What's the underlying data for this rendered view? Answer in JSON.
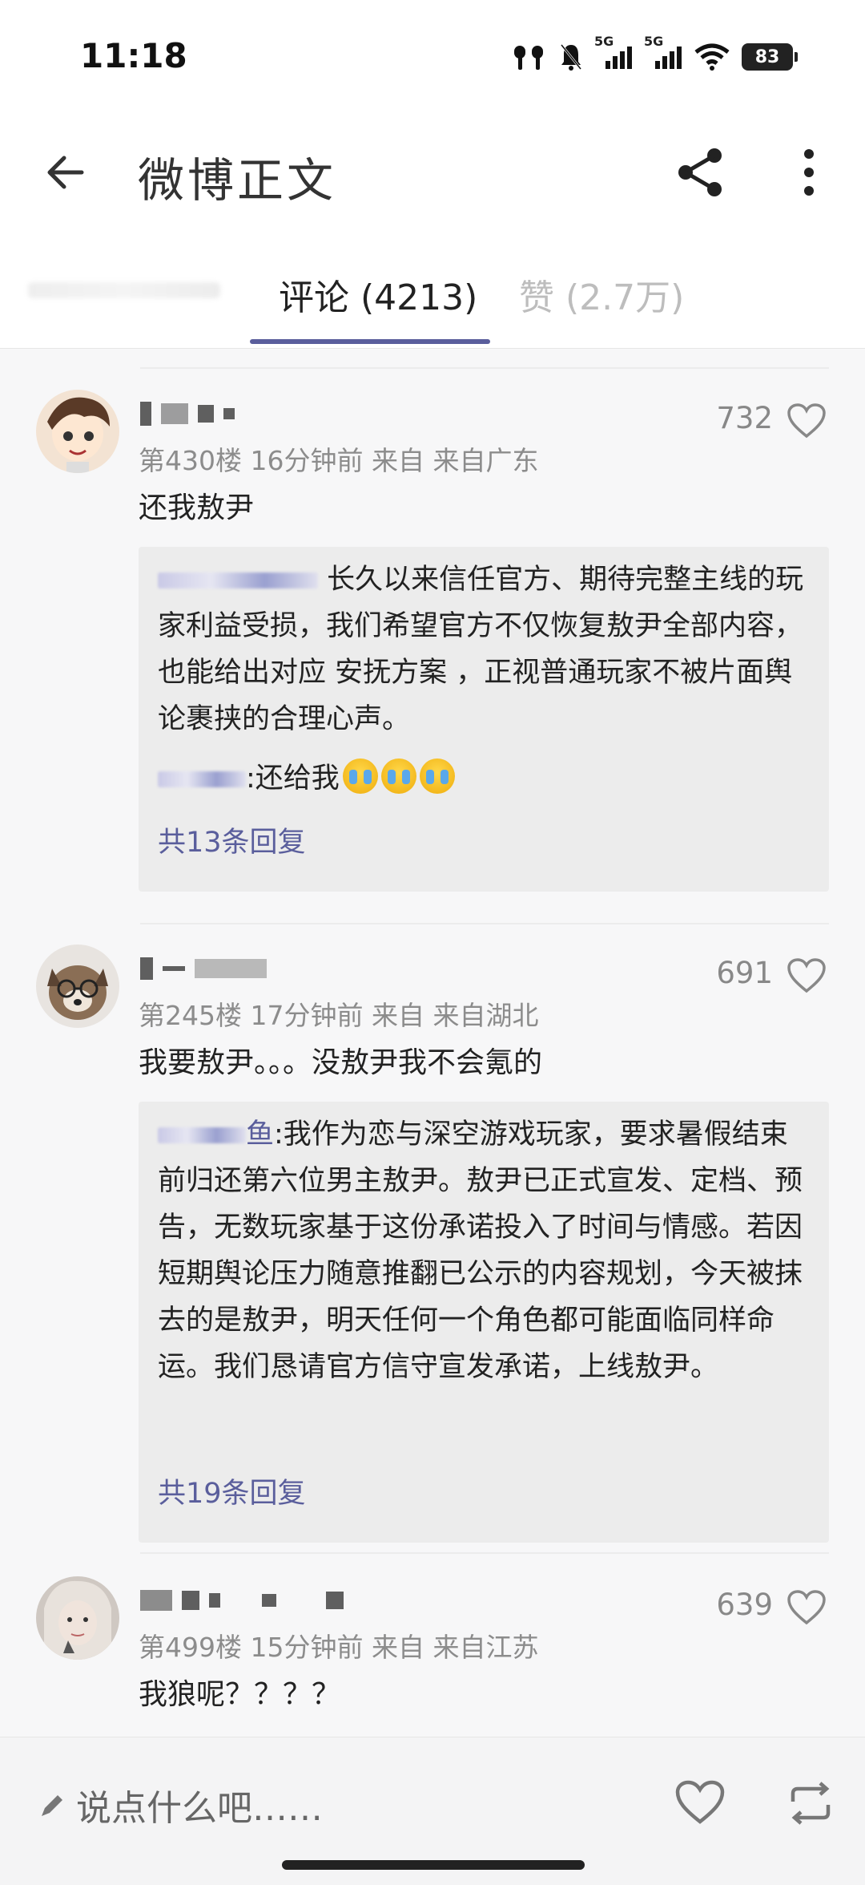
{
  "status_bar": {
    "time": "11:18",
    "network_1": "5G",
    "network_2": "5G",
    "battery": "83",
    "icons": [
      "earbuds-icon",
      "mute-bell-icon",
      "signal-icon",
      "signal-icon",
      "wifi-icon",
      "battery-icon"
    ]
  },
  "header": {
    "title": "微博正文",
    "back_icon": "arrow-left-icon",
    "share_icon": "share-icon",
    "more_icon": "more-vertical-icon"
  },
  "tabs": {
    "comments": "评论 (4213)",
    "likes": "赞 (2.7万)",
    "accent": "#5a5e9c"
  },
  "comments": [
    {
      "likes": "732",
      "meta": "第430楼 16分钟前 来自 来自广东",
      "text": "还我敖尹",
      "reply": {
        "main": "长久以来信任官方、期待完整主线的玩家利益受损，我们希望官方不仅恢复敖尹全部内容，也能给出对应 安抚方案 ，正视普通玩家不被片面舆论裹挟的合理心声。",
        "second_suffix": ":还给我",
        "more": "共13条回复"
      }
    },
    {
      "likes": "691",
      "meta": "第245楼 17分钟前 来自 来自湖北",
      "text": "我要敖尹。。。没敖尹我不会氪的",
      "reply": {
        "name_suffix": "鱼",
        "main": ":我作为恋与深空游戏玩家，要求暑假结束前归还第六位男主敖尹。敖尹已正式宣发、定档、预告，无数玩家基于这份承诺投入了时间与情感。若因短期舆论压力随意推翻已公示的内容规划，今天被抹去的是敖尹，明天任何一个角色都可能面临同样命运。我们恳请官方信守宣发承诺，上线敖尹。",
        "more": "共19条回复"
      }
    },
    {
      "likes": "639",
      "meta": "第499楼 15分钟前 来自 来自江苏",
      "text": "我狼呢？？？？"
    }
  ],
  "bottom_bar": {
    "placeholder": "说点什么吧……",
    "icons": [
      "pencil-icon",
      "heart-icon",
      "repost-icon"
    ]
  }
}
